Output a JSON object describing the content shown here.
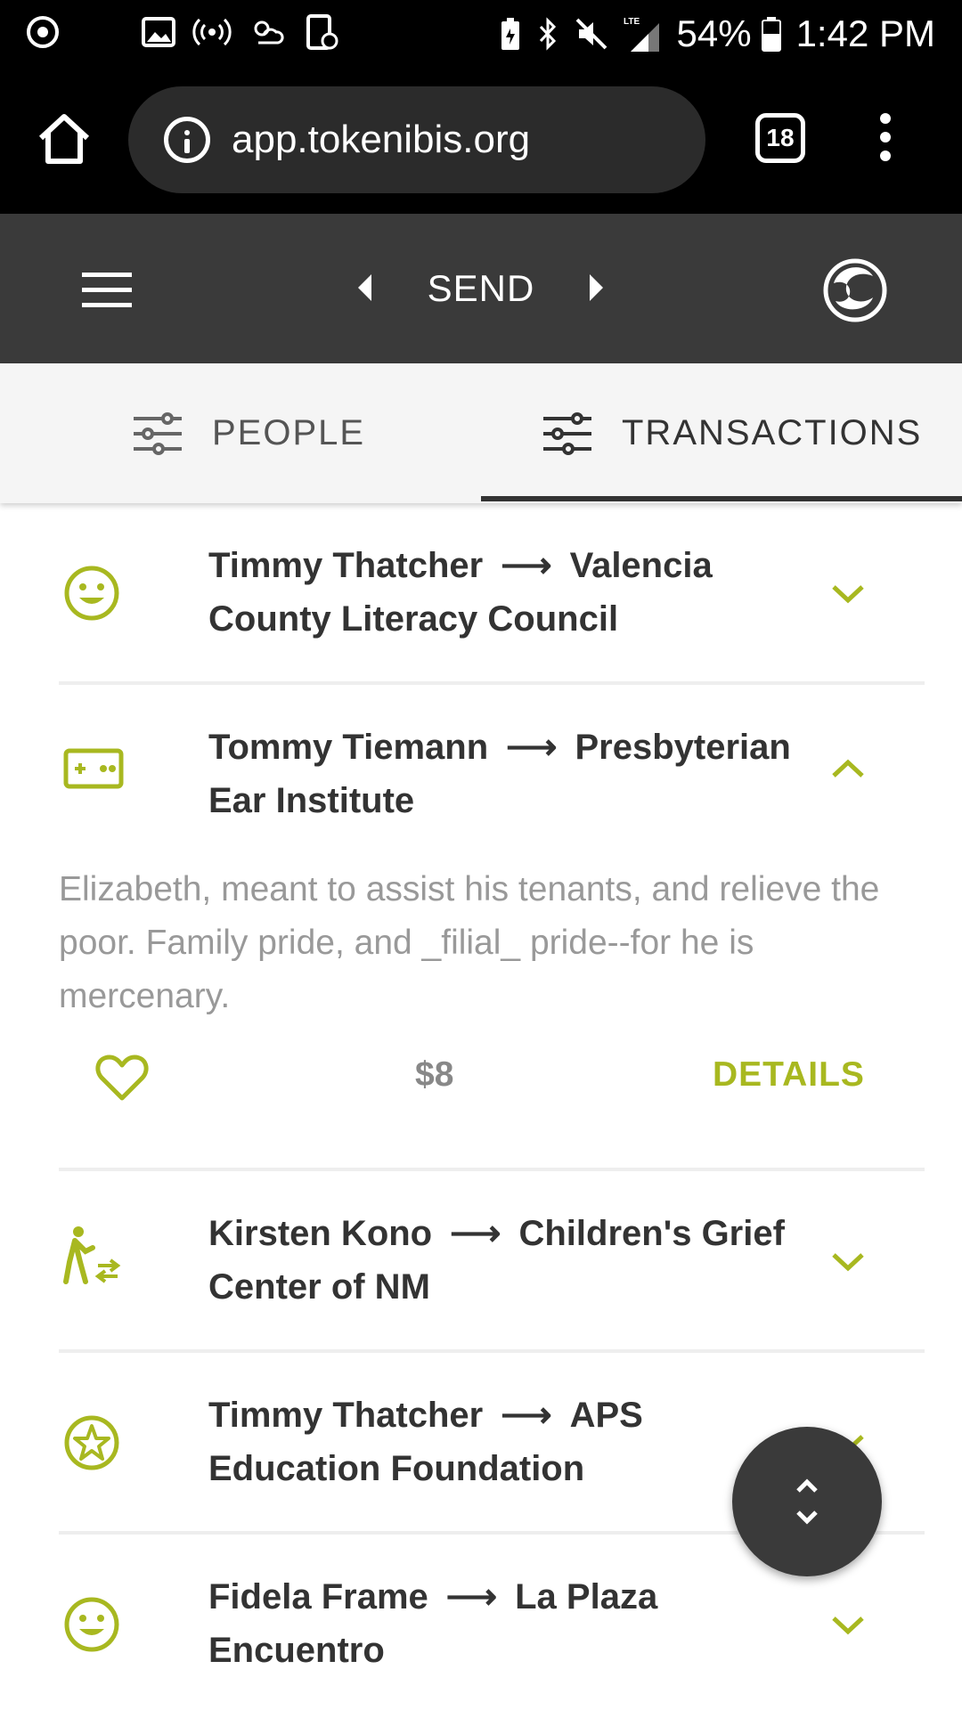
{
  "status_bar": {
    "battery_pct": "54%",
    "time": "1:42 PM",
    "network": "LTE",
    "icons": [
      "sync-icon",
      "image-icon",
      "hotspot-icon",
      "weather-icon",
      "screenshot-icon",
      "battery-saver-icon",
      "bluetooth-icon",
      "mute-icon",
      "signal-icon",
      "battery-icon"
    ]
  },
  "browser": {
    "url": "app.tokenibis.org",
    "tab_count": "18"
  },
  "header": {
    "title": "SEND"
  },
  "tabs": [
    {
      "label": "PEOPLE",
      "active": false
    },
    {
      "label": "TRANSACTIONS",
      "active": true
    }
  ],
  "transactions": [
    {
      "from": "Timmy Thatcher",
      "to_line1": "Valencia",
      "to_line2": "County Literacy Council",
      "icon": "smiley-icon",
      "expanded": false
    },
    {
      "from": "Tommy Tiemann",
      "to_line1": "Presbyterian",
      "to_line2": "Ear Institute",
      "icon": "gamepad-icon",
      "expanded": true,
      "description": "Elizabeth, meant to assist his tenants, and relieve the poor. Family pride, and _filial_ pride--for he is mercenary.",
      "amount": "$8",
      "details_label": "DETAILS"
    },
    {
      "from": "Kirsten Kono",
      "to_line1": "Children's Grief",
      "to_line2": "Center of NM",
      "icon": "walking-transfer-icon",
      "expanded": false
    },
    {
      "from": "Timmy Thatcher",
      "to_line1": "APS",
      "to_line2": "Education Foundation",
      "icon": "star-circle-icon",
      "expanded": false
    },
    {
      "from": "Fidela Frame",
      "to_line1": "La Plaza",
      "to_line2": "Encuentro",
      "icon": "smiley-icon",
      "expanded": false
    }
  ],
  "arrow_glyph": "⟶",
  "colors": {
    "accent": "#a8b820",
    "header_bg": "#3a3a3a",
    "browser_bg": "#000000"
  }
}
